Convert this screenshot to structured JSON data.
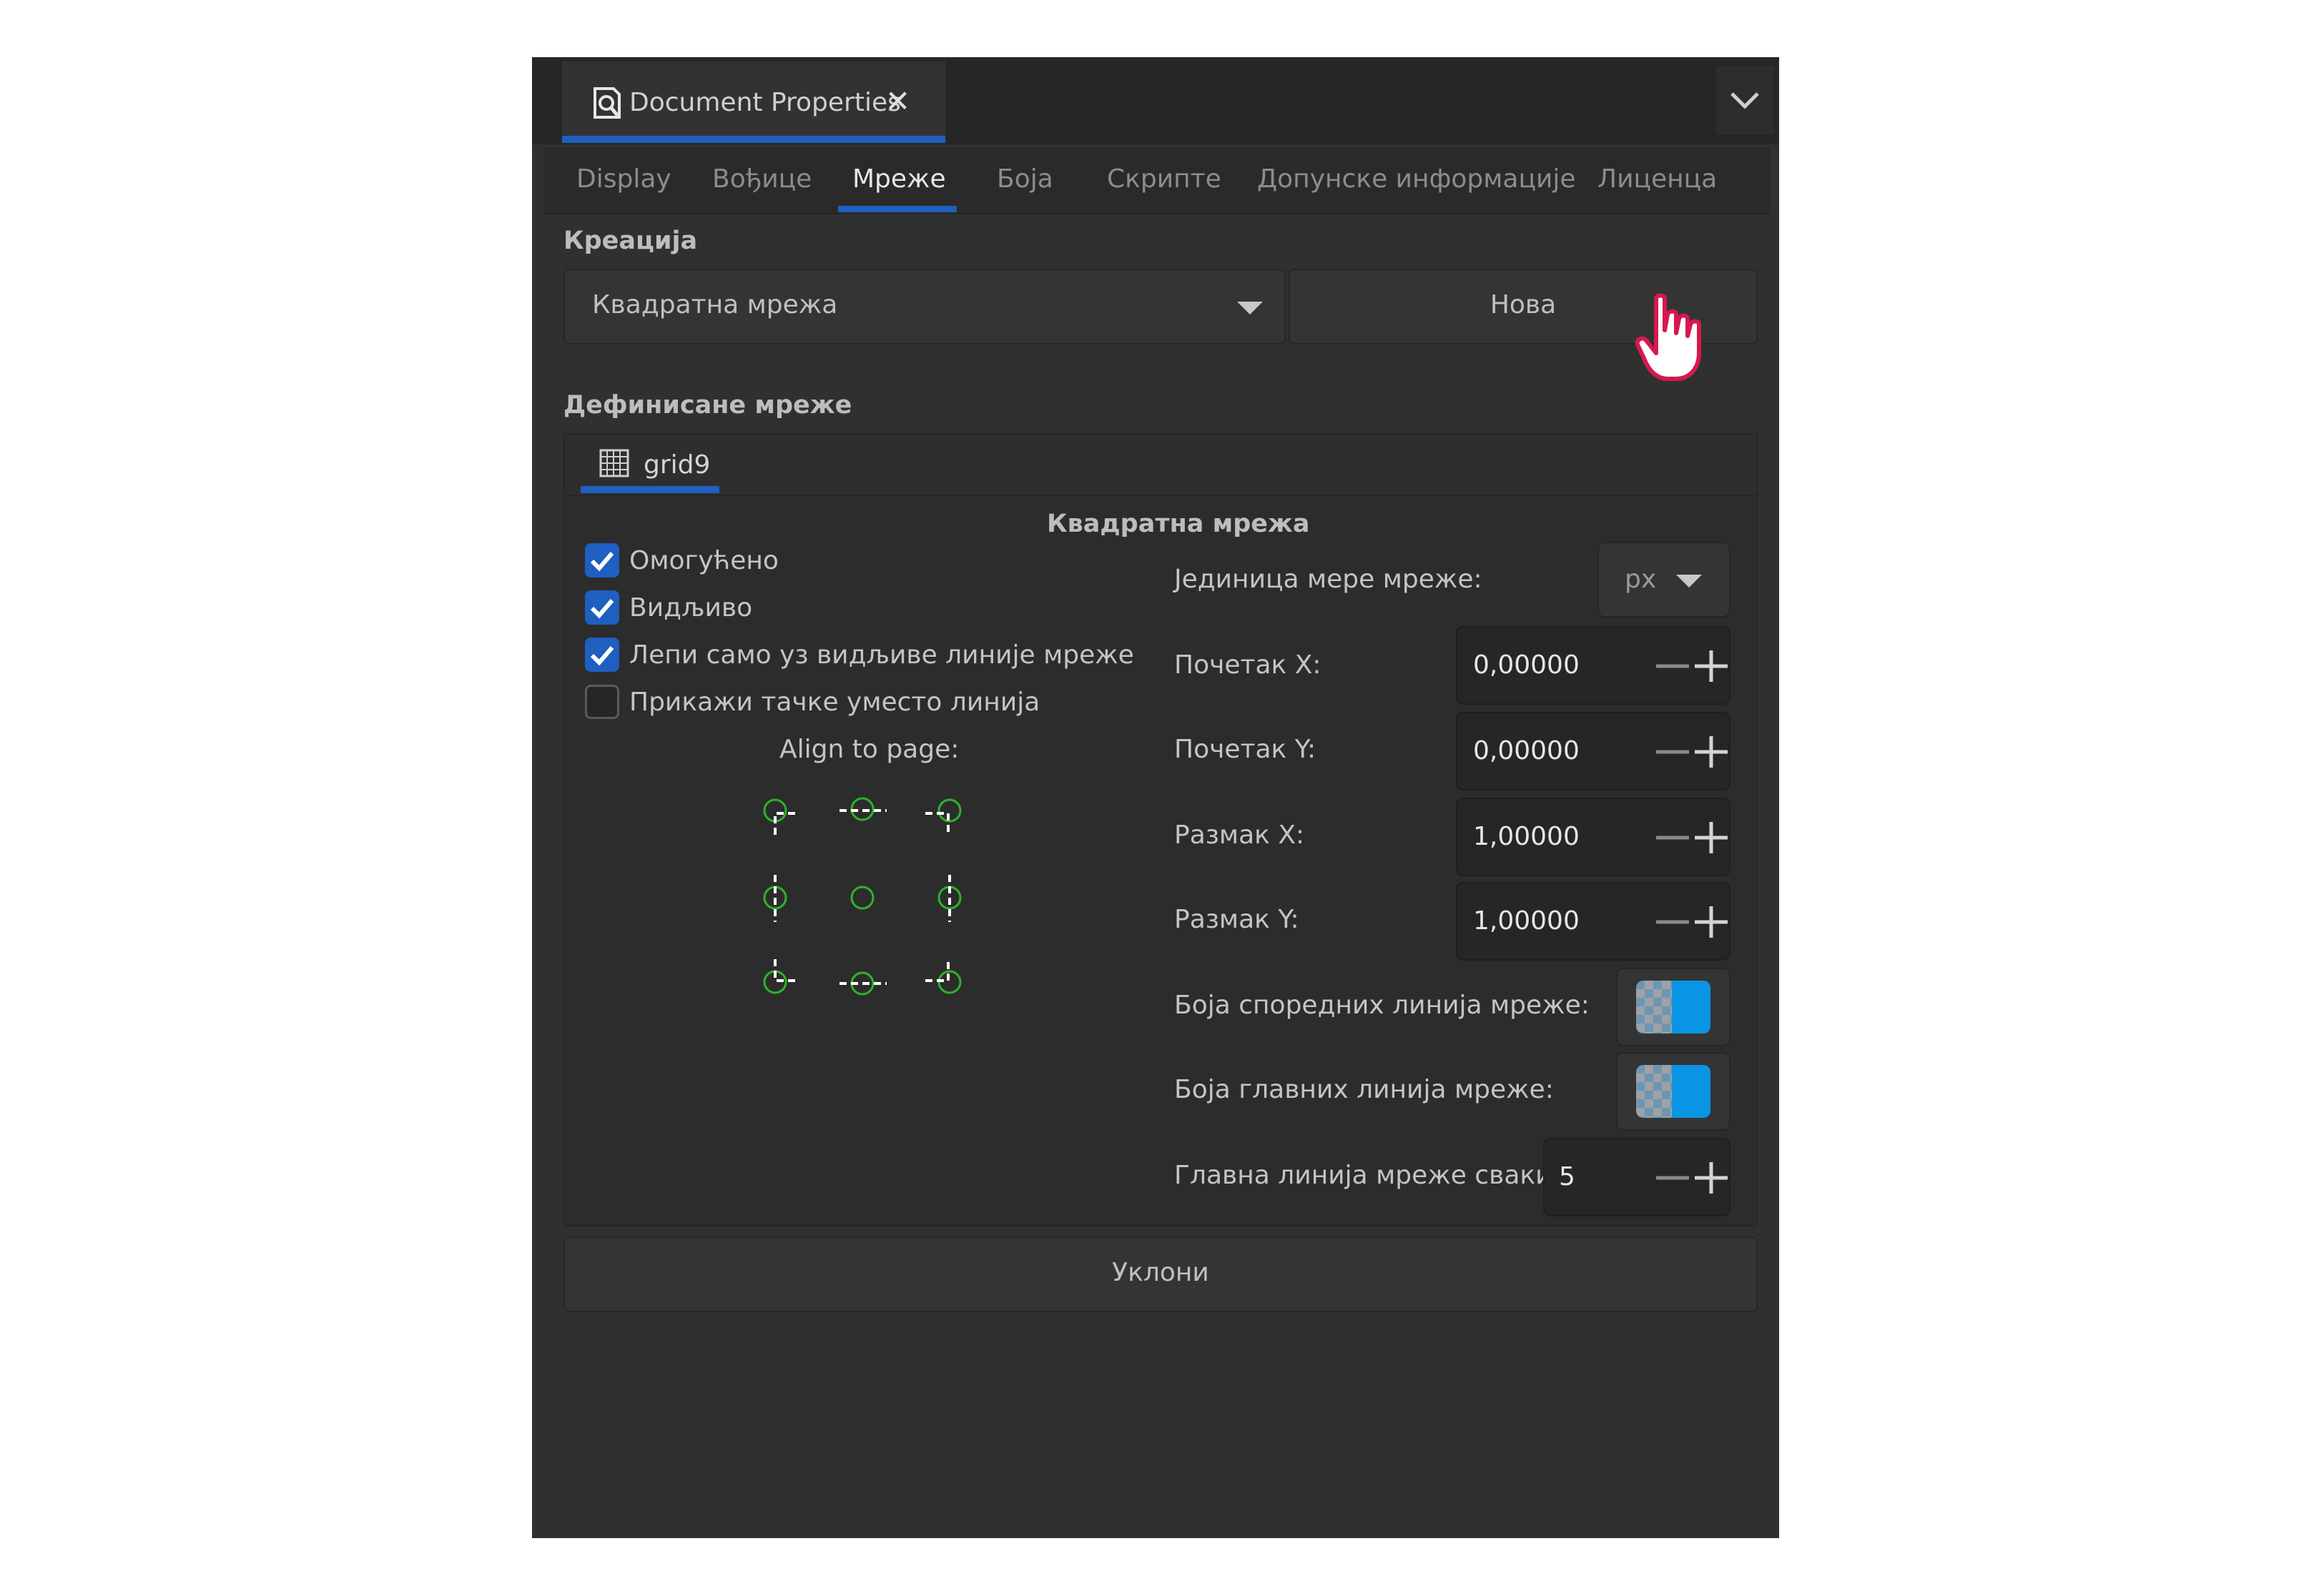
{
  "panel": {
    "doc_tab_title": "Document Properties",
    "doc_tab_close": "✕"
  },
  "tabs": [
    {
      "label": "Display"
    },
    {
      "label": "Вођице"
    },
    {
      "label": "Мреже",
      "active": true
    },
    {
      "label": "Боја"
    },
    {
      "label": "Скрипте"
    },
    {
      "label": "Допунске информације"
    },
    {
      "label": "Лиценца"
    }
  ],
  "creation": {
    "title": "Креација",
    "combo_value": "Квадратна мрежа",
    "new_label": "Нова"
  },
  "defined": {
    "title": "Дефинисане мреже",
    "grid_tab_label": "grid9",
    "grid_type_title": "Квадратна мрежа"
  },
  "options": {
    "enabled_label": "Омогућено",
    "enabled_checked": true,
    "visible_label": "Видљиво",
    "visible_checked": true,
    "snap_label": "Лепи само уз видљиве линије мреже",
    "snap_checked": true,
    "dots_label": "Прикажи тачке уместо линија",
    "dots_checked": false,
    "align_label": "Align to page:"
  },
  "fields": {
    "unit_label": "Јединица мере мреже:",
    "unit_value": "px",
    "origin_x_label": "Почетак X:",
    "origin_x_value": "0,00000",
    "origin_y_label": "Почетак Y:",
    "origin_y_value": "0,00000",
    "spacing_x_label": "Размак X:",
    "spacing_x_value": "1,00000",
    "spacing_y_label": "Размак Y:",
    "spacing_y_value": "1,00000",
    "minor_color_label": "Боја споредних линија мреже:",
    "major_color_label": "Боја главних линија мреже:",
    "major_every_label": "Главна линија мреже сваких:",
    "major_every_value": "5"
  },
  "remove_label": "Уклони",
  "colors": {
    "accent": "#1f5fbf",
    "panel_bg": "#303030",
    "align_marker": "#2bb52b",
    "cursor": "#d6184f",
    "swatch_blue": "#0a94e6"
  }
}
